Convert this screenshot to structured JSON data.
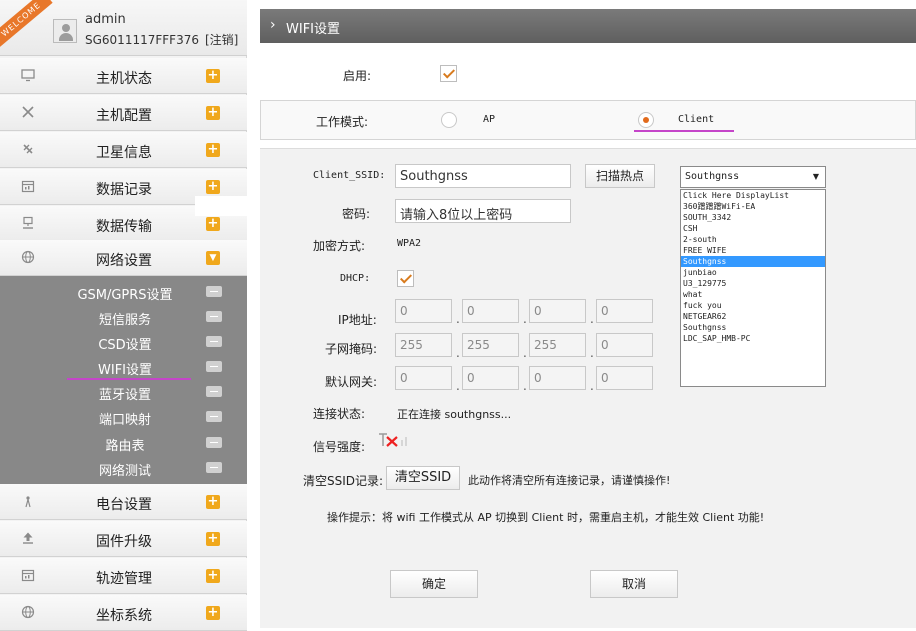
{
  "sidebar": {
    "welcome": "WELCOME",
    "user": "admin",
    "device_id": "SG6011117FFF376",
    "logout": "[注销]",
    "items": [
      {
        "label": "主机状态",
        "icon": "monitor-icon"
      },
      {
        "label": "主机配置",
        "icon": "tools-icon"
      },
      {
        "label": "卫星信息",
        "icon": "satellite-icon"
      },
      {
        "label": "数据记录",
        "icon": "calendar-icon"
      },
      {
        "label": "数据传输",
        "icon": "network-icon"
      },
      {
        "label": "网络设置",
        "icon": "globe-icon"
      },
      {
        "label": "电台设置",
        "icon": "radio-antenna-icon"
      },
      {
        "label": "固件升级",
        "icon": "upload-icon"
      },
      {
        "label": "轨迹管理",
        "icon": "calendar-icon"
      },
      {
        "label": "坐标系统",
        "icon": "globe-icon"
      }
    ],
    "subitems": [
      "GSM/GPRS设置",
      "短信服务",
      "CSD设置",
      "WIFI设置",
      "蓝牙设置",
      "端口映射",
      "路由表",
      "网络测试"
    ]
  },
  "header": {
    "title": "WIFI设置"
  },
  "form": {
    "enable_label": "启用:",
    "mode_label": "工作模式:",
    "mode_ap": "AP",
    "mode_client": "Client",
    "ssid_label": "Client_SSID:",
    "ssid_value": "Southgnss",
    "scan_button": "扫描热点",
    "password_label": "密码:",
    "password_placeholder": "请输入8位以上密码",
    "encryption_label": "加密方式:",
    "encryption_value": "WPA2",
    "dhcp_label": "DHCP:",
    "ip_label": "IP地址:",
    "ip": [
      "0",
      "0",
      "0",
      "0"
    ],
    "mask_label": "子网掩码:",
    "mask": [
      "255",
      "255",
      "255",
      "0"
    ],
    "gateway_label": "默认网关:",
    "gateway": [
      "0",
      "0",
      "0",
      "0"
    ],
    "status_label": "连接状态:",
    "status_value": "正在连接 southgnss...",
    "signal_label": "信号强度:",
    "clear_label": "清空SSID记录:",
    "clear_button": "清空SSID",
    "clear_warning": "此动作将清空所有连接记录，请谨慎操作!",
    "hint": "操作提示：将 wifi 工作模式从 AP 切换到 Client 时，需重启主机，才能生效 Client 功能!",
    "confirm_button": "确定",
    "cancel_button": "取消"
  },
  "ssid_dropdown": {
    "selected": "Southgnss",
    "options": [
      "Click Here DisplayList",
      "360蹭蹭蹭WiFi-EA",
      "SOUTH_3342",
      "CSH",
      "2-south",
      "FREE WIFE",
      "Southgnss",
      "junbiao",
      "U3_129775",
      "what",
      "fuck you",
      "NETGEAR62",
      "Southgnss",
      "LDC_SAP_HMB-PC"
    ],
    "highlighted_index": 6
  },
  "colors": {
    "accent": "#e26a1b",
    "badge": "#f0a81c",
    "highlight": "#3399ff",
    "annotation": "#c545c9"
  }
}
